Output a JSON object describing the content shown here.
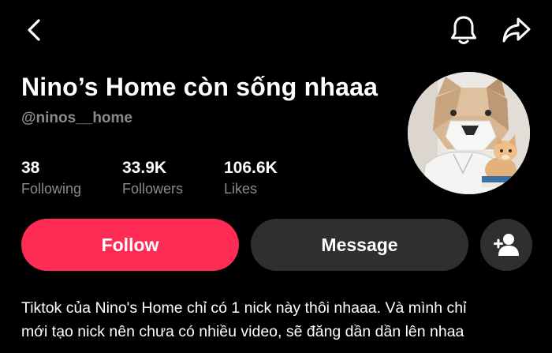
{
  "header": {
    "back_icon": "chevron-left-icon",
    "bell_icon": "bell-icon",
    "share_icon": "share-arrow-icon"
  },
  "profile": {
    "display_name": "Nino’s Home còn sống nhaaa",
    "username": "@ninos__home"
  },
  "stats": [
    {
      "value": "38",
      "label": "Following"
    },
    {
      "value": "33.9K",
      "label": "Followers"
    },
    {
      "value": "106.6K",
      "label": "Likes"
    }
  ],
  "actions": {
    "follow_label": "Follow",
    "message_label": "Message",
    "add_friend_icon": "person-plus-icon"
  },
  "bio": {
    "line1": "Tiktok của Nino's Home chỉ có 1 nick này thôi nhaaa. Và mình chỉ",
    "line2": "mới tạo nick nên chưa có nhiều video, sẽ đăng dần dần lên nhaa"
  },
  "colors": {
    "background": "#000000",
    "follow_button": "#fe2c55",
    "secondary_button": "#2f2f2f",
    "muted_text": "#8a8a8e"
  }
}
